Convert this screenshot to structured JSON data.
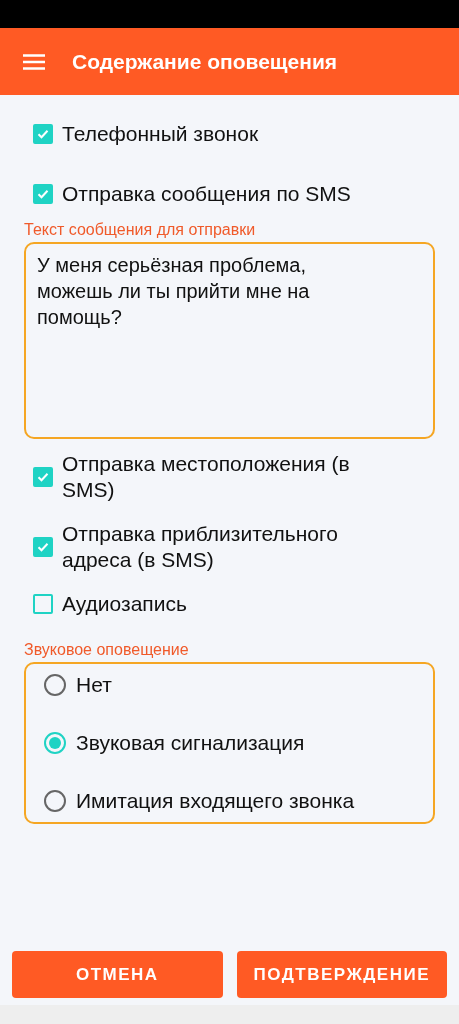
{
  "app_bar": {
    "title": "Содержание оповещения"
  },
  "options_top": [
    {
      "label": "Телефонный звонок",
      "checked": true
    },
    {
      "label": "Отправка сообщения по SMS",
      "checked": true
    }
  ],
  "message": {
    "label": "Текст сообщения для отправки",
    "value": "У меня серьёзная проблема, можешь ли ты прийти мне на помощь?"
  },
  "options_bottom": [
    {
      "label": "Отправка местоположения (в SMS)",
      "checked": true
    },
    {
      "label": "Отправка приблизительного адреса (в SMS)",
      "checked": true
    },
    {
      "label": "Аудиозапись",
      "checked": false
    }
  ],
  "sound": {
    "label": "Звуковое оповещение",
    "options": [
      {
        "label": "Нет",
        "selected": false
      },
      {
        "label": "Звуковая сигнализация",
        "selected": true
      },
      {
        "label": "Имитация входящего звонка",
        "selected": false
      }
    ]
  },
  "buttons": [
    {
      "label": "ОТМЕНА"
    },
    {
      "label": "ПОДТВЕРЖДЕНИЕ"
    }
  ]
}
